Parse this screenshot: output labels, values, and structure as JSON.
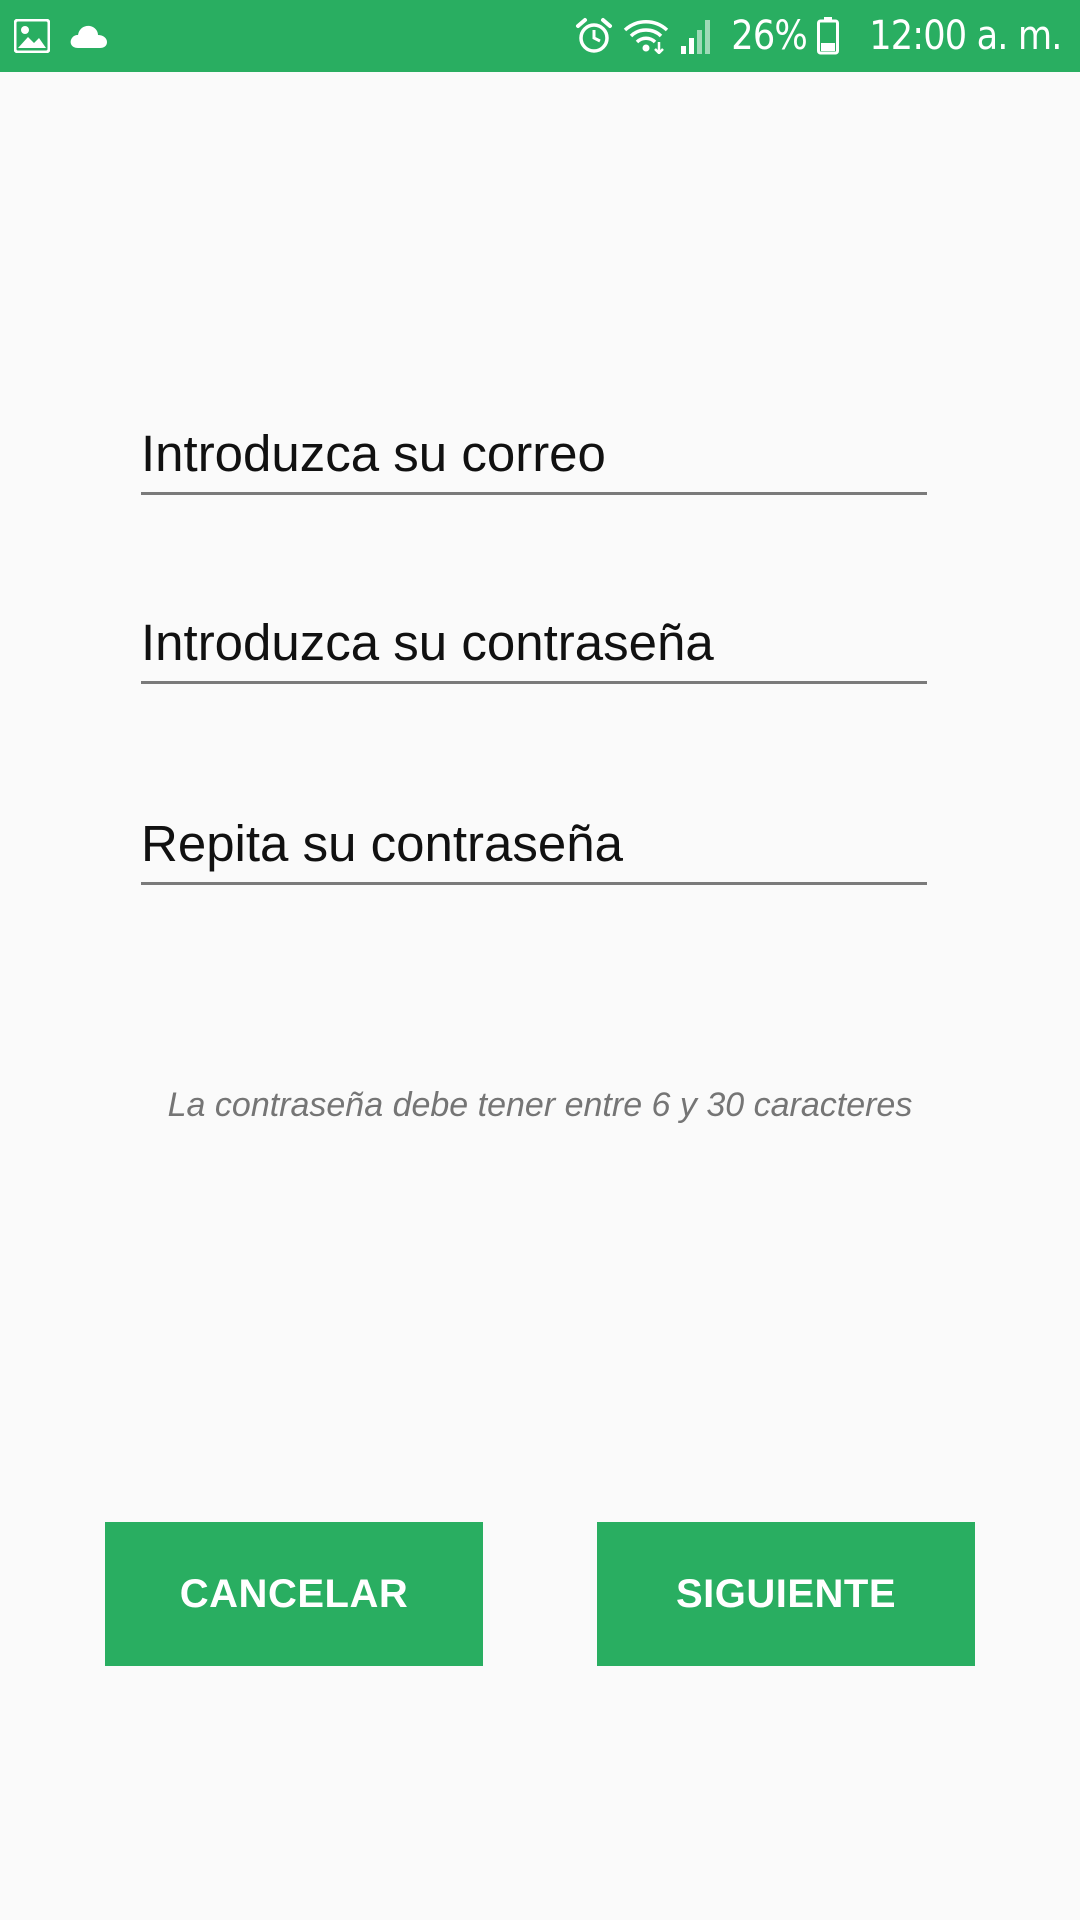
{
  "status_bar": {
    "icons_left": [
      "gallery-icon",
      "cloud-icon"
    ],
    "icons_right": [
      "alarm-icon",
      "wifi-icon",
      "signal-icon",
      "battery-icon"
    ],
    "battery_percent": "26%",
    "time": "12:00 a. m.",
    "background_color": "#29ae61"
  },
  "form": {
    "email_placeholder": "Introduzca su correo",
    "email_value": "",
    "password_placeholder": "Introduzca su contraseña",
    "password_value": "",
    "repeat_placeholder": "Repita su contraseña",
    "repeat_value": "",
    "hint": "La contraseña debe tener entre 6 y 30 caracteres"
  },
  "buttons": {
    "cancel_label": "CANCELAR",
    "next_label": "SIGUIENTE",
    "color": "#29ae61"
  }
}
